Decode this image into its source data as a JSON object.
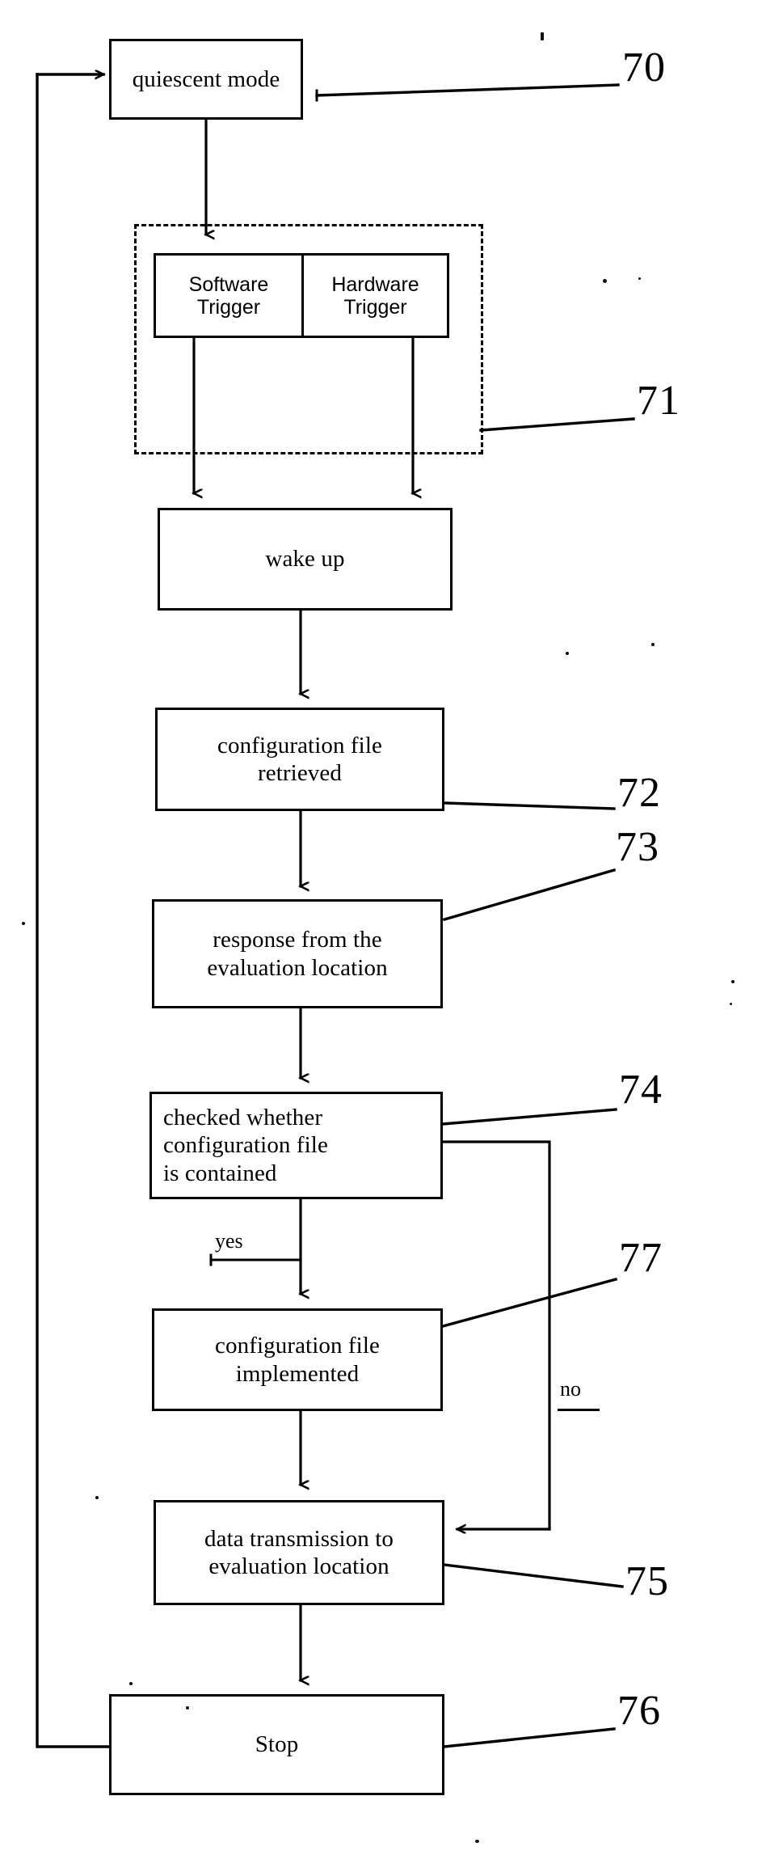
{
  "figure": {
    "type": "patent-flowchart",
    "title": "",
    "nodes": [
      {
        "id": "n70",
        "ref": "70",
        "label": "quiescent mode",
        "shape": "rect",
        "font": "serif",
        "align": "center"
      },
      {
        "id": "sw",
        "ref": "",
        "label": "Software\nTrigger",
        "shape": "rect",
        "font": "sans",
        "align": "center"
      },
      {
        "id": "hw",
        "ref": "",
        "label": "Hardware\nTrigger",
        "shape": "rect",
        "font": "sans",
        "align": "center"
      },
      {
        "id": "n71",
        "ref": "71",
        "label": "wake up",
        "shape": "rect",
        "font": "serif",
        "align": "center"
      },
      {
        "id": "n72",
        "ref": "72",
        "label": "configuration file\nretrieved",
        "shape": "rect",
        "font": "serif",
        "align": "center"
      },
      {
        "id": "n73",
        "ref": "73",
        "label": "response from the\nevaluation location",
        "shape": "rect",
        "font": "serif",
        "align": "center"
      },
      {
        "id": "n74",
        "ref": "74",
        "label": "checked whether\nconfiguration file\nis contained",
        "shape": "rect",
        "font": "serif",
        "align": "left"
      },
      {
        "id": "n77",
        "ref": "77",
        "label": "configuration file\nimplemented",
        "shape": "rect",
        "font": "serif",
        "align": "center"
      },
      {
        "id": "n75",
        "ref": "75",
        "label": "data transmission to\nevaluation location",
        "shape": "rect",
        "font": "serif",
        "align": "center"
      },
      {
        "id": "n76",
        "ref": "76",
        "label": "Stop",
        "shape": "rect",
        "font": "serif",
        "align": "center"
      }
    ],
    "boxes": {
      "quiescent_mode": {
        "text": "quiescent mode"
      },
      "software_trigger": {
        "line1": "Software",
        "line2": "Trigger"
      },
      "hardware_trigger": {
        "line1": "Hardware",
        "line2": "Trigger"
      },
      "wake_up": {
        "text": "wake up"
      },
      "config_retrieved": {
        "line1": "configuration file",
        "line2": "retrieved"
      },
      "response": {
        "line1": "response from the",
        "line2": "evaluation location"
      },
      "checked": {
        "line1": "checked whether",
        "line2": "configuration file",
        "line3": "is contained"
      },
      "implemented": {
        "line1": "configuration file",
        "line2": "implemented"
      },
      "transmission": {
        "line1": "data transmission to",
        "line2": "evaluation location"
      },
      "stop": {
        "text": "Stop"
      }
    },
    "refs": {
      "r70": "70",
      "r71": "71",
      "r72": "72",
      "r73": "73",
      "r74": "74",
      "r77": "77",
      "r75": "75",
      "r76": "76"
    },
    "edge_labels": {
      "yes": "yes",
      "no": "no"
    },
    "colors": {
      "ink": "#000000",
      "paper": "#ffffff"
    },
    "dashed_group_ref": "71"
  }
}
